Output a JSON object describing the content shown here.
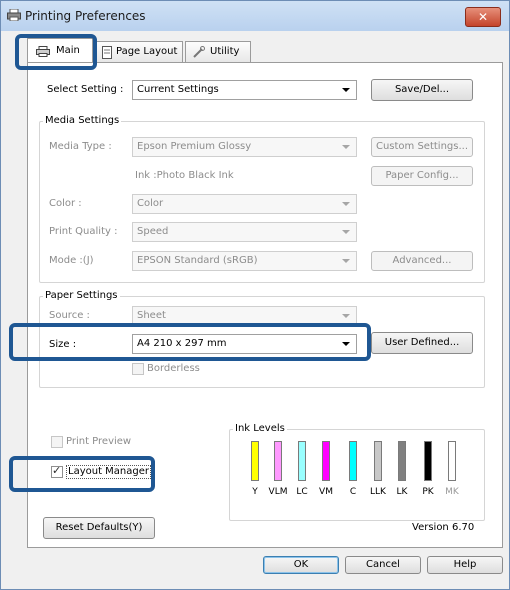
{
  "window": {
    "title": "Printing Preferences",
    "close_label": "✕"
  },
  "tabs": [
    {
      "label": "Main"
    },
    {
      "label": "Page Layout"
    },
    {
      "label": "Utility"
    }
  ],
  "select_setting": {
    "label": "Select Setting :",
    "value": "Current Settings",
    "save_button": "Save/Del..."
  },
  "media_settings": {
    "title": "Media Settings",
    "media_type_label": "Media Type :",
    "media_type_value": "Epson Premium Glossy",
    "custom_settings_button": "Custom Settings...",
    "ink_text": "Ink :Photo Black Ink",
    "paper_config_button": "Paper Config...",
    "color_label": "Color :",
    "color_value": "Color",
    "print_quality_label": "Print Quality :",
    "print_quality_value": "Speed",
    "mode_label": "Mode :(J)",
    "mode_value": "EPSON Standard (sRGB)",
    "advanced_button": "Advanced..."
  },
  "paper_settings": {
    "title": "Paper Settings",
    "source_label": "Source :",
    "source_value": "Sheet",
    "size_label": "Size :",
    "size_value": "A4 210 x 297 mm",
    "user_defined_button": "User Defined...",
    "borderless_label": "Borderless"
  },
  "options": {
    "print_preview_label": "Print Preview",
    "layout_manager_label": "Layout Manager",
    "layout_manager_checked": "✓"
  },
  "ink_levels": {
    "title": "Ink Levels",
    "inks": [
      {
        "name": "Y",
        "color": "#ffff00",
        "level": 1.0
      },
      {
        "name": "VLM",
        "color": "#ff99ff",
        "level": 1.0
      },
      {
        "name": "LC",
        "color": "#99ffff",
        "level": 1.0
      },
      {
        "name": "VM",
        "color": "#ff00ff",
        "level": 1.0
      },
      {
        "name": "C",
        "color": "#00ffff",
        "level": 1.0
      },
      {
        "name": "LLK",
        "color": "#c8c8c8",
        "level": 1.0
      },
      {
        "name": "LK",
        "color": "#808080",
        "level": 1.0
      },
      {
        "name": "PK",
        "color": "#000000",
        "level": 1.0
      },
      {
        "name": "MK",
        "color": "#ffffff",
        "level": 0.0
      }
    ]
  },
  "footer": {
    "reset_defaults": "Reset Defaults(Y)",
    "version": "Version 6.70"
  },
  "dialog_buttons": {
    "ok": "OK",
    "cancel": "Cancel",
    "help": "Help"
  }
}
